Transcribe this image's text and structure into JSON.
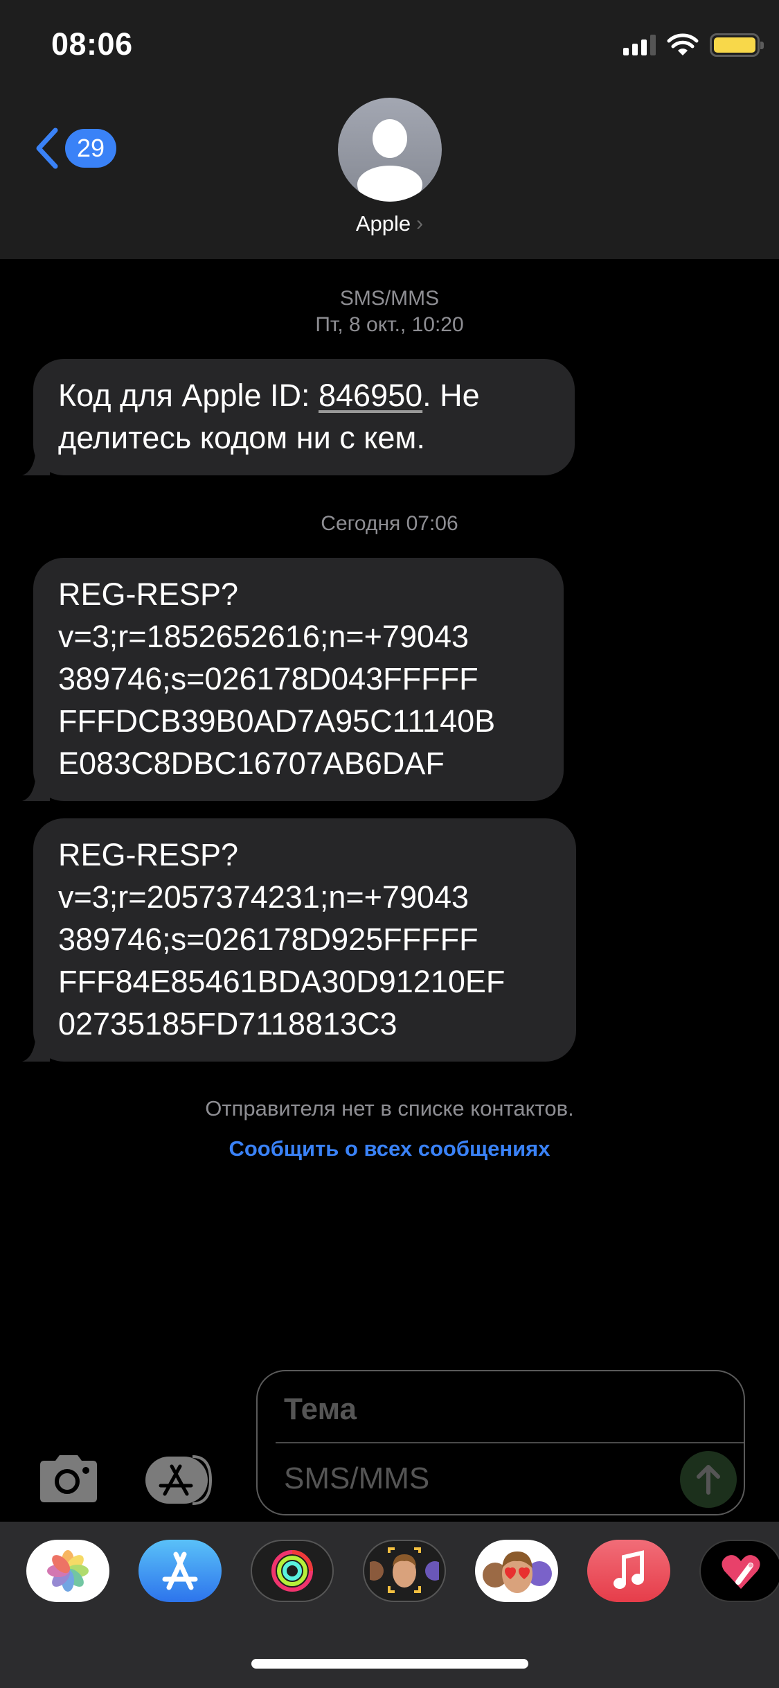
{
  "status_bar": {
    "time": "08:06",
    "signal_bars_active": 3,
    "signal_bars_total": 4,
    "wifi": "wifi-icon",
    "battery_mode": "low-power",
    "battery_color": "#f8d84a"
  },
  "header": {
    "back_badge_count": "29",
    "contact_name": "Apple",
    "accent_color": "#3a82f7"
  },
  "conversation": {
    "groups": [
      {
        "service": "SMS/MMS",
        "timestamp": "Пт, 8 окт., 10:20",
        "messages": [
          {
            "lines": [
              "Код для Apple ID: ",
              "846950",
              ". Не",
              "делитесь кодом ни с кем."
            ],
            "code": "846950"
          }
        ]
      },
      {
        "timestamp": "Сегодня 07:06",
        "messages": [
          {
            "lines": [
              "REG-RESP?",
              "v=3;r=1852652616;n=+79043",
              "389746;s=026178D043FFFFF",
              "FFFDCB39B0AD7A95C11140B",
              "E083C8DBC16707AB6DAF"
            ]
          },
          {
            "lines": [
              "REG-RESP?",
              "v=3;r=2057374231;n=+79043",
              "389746;s=026178D925FFFFF",
              "FFF84E85461BDA30D91210EF",
              "02735185FD7118813C3"
            ]
          }
        ]
      }
    ],
    "unknown_sender_notice": "Отправителя нет в списке контактов.",
    "report_link": "Сообщить о всех сообщениях"
  },
  "composer": {
    "subject_placeholder": "Тема",
    "message_placeholder": "SMS/MMS",
    "send_color": "#1c301c"
  },
  "app_drawer": {
    "apps": [
      {
        "name": "photos-app-icon",
        "bg": "#ffffff"
      },
      {
        "name": "app-store-app-icon",
        "bg": "#2f86f0"
      },
      {
        "name": "activity-app-icon",
        "bg": "#1e1e1e"
      },
      {
        "name": "memoji-app-icon",
        "bg": "#1e1e1e"
      },
      {
        "name": "memoji-stickers-app-icon",
        "bg": "#ffffff"
      },
      {
        "name": "music-app-icon",
        "bg": "#ea4c5a"
      },
      {
        "name": "digital-touch-app-icon",
        "bg": "#000000"
      }
    ]
  }
}
